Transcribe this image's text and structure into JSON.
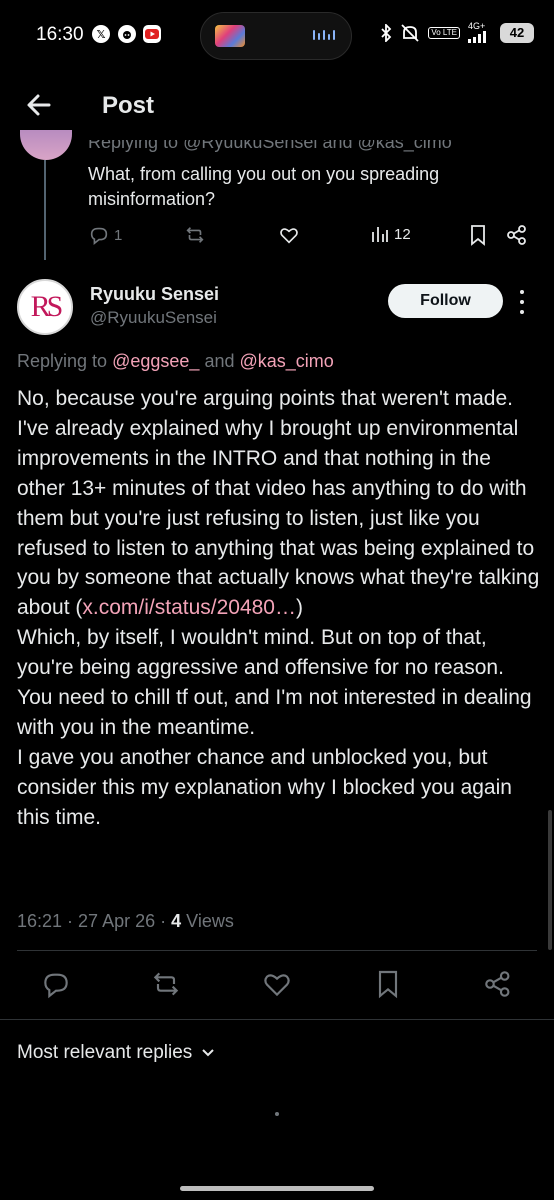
{
  "status_bar": {
    "time": "16:30",
    "volte": "Vo LTE",
    "network": "4G+",
    "battery": "42"
  },
  "header": {
    "title": "Post"
  },
  "previous_reply": {
    "replying_prefix": "Replying to",
    "mention_1": "@RyuukuSensei",
    "and": "and",
    "mention_2": "@kas_cimo",
    "text": "What, from calling you out on you spreading misinformation?",
    "reply_count": "1",
    "views_count": "12"
  },
  "tweet": {
    "author_name": "Ryuuku Sensei",
    "author_handle": "@RyuukuSensei",
    "avatar_letters": "RS",
    "follow_label": "Follow",
    "replying_prefix": "Replying to",
    "mention_1": "@eggsee_",
    "and": "and",
    "mention_2": "@kas_cimo",
    "body_1": "No, because you're arguing points that weren't made. I've already explained why I brought up environmental improvements in the INTRO and that nothing in the other 13+ minutes of that video has anything to do with them but you're just refusing to listen, just like you refused to listen to anything that was being explained to you by someone that actually knows what they're talking about (",
    "link": "x.com/i/status/20480…",
    "body_1_end": ")",
    "body_2": "Which, by itself, I wouldn't mind. But on top of that, you're being aggressive and offensive for no reason.",
    "body_3": "You need to chill tf out, and I'm not interested in dealing with you in the meantime.",
    "body_4": "I gave you another chance and unblocked you, but consider this my explanation why I blocked you again this time.",
    "time": "16:21",
    "date": "27 Apr 26",
    "views_count": "4",
    "views_label": "Views"
  },
  "replies_sort": {
    "label": "Most relevant replies"
  },
  "colors": {
    "background": "#000000",
    "text": "#e7e9ea",
    "secondary": "#71767b",
    "accent": "#f3a3b8",
    "divider": "#2f3336"
  }
}
